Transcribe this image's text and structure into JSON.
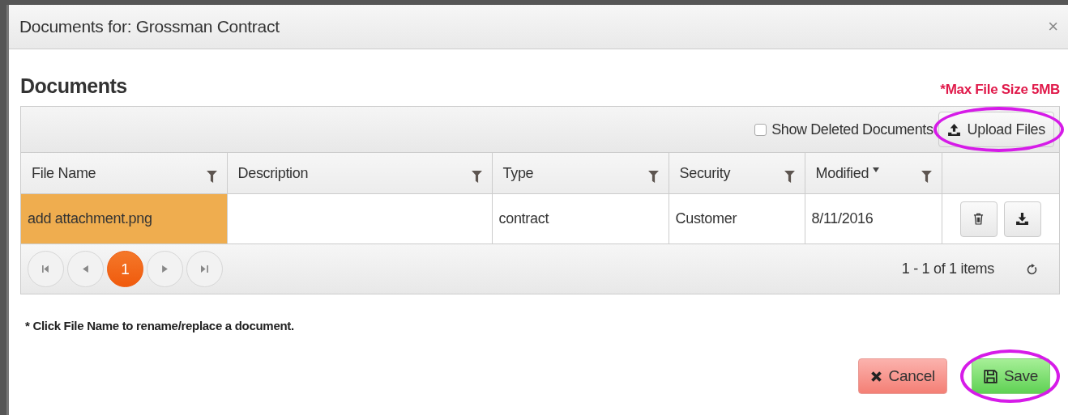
{
  "dialog": {
    "title": "Documents for: Grossman Contract",
    "close": "×"
  },
  "heading": "Documents",
  "max_size_note": "*Max File Size 5MB",
  "toolbar": {
    "show_deleted": {
      "label": "Show Deleted Documents",
      "checked": false
    },
    "upload": {
      "label": "Upload Files",
      "circled": true
    }
  },
  "table": {
    "columns": [
      {
        "label": "File Name",
        "sorted": false
      },
      {
        "label": "Description",
        "sorted": false
      },
      {
        "label": "Type",
        "sorted": false
      },
      {
        "label": "Security",
        "sorted": false
      },
      {
        "label": "Modified",
        "sorted": true
      }
    ],
    "rows": [
      {
        "cells": [
          "add attachment.png",
          "",
          "contract",
          "Customer",
          "8/11/2016"
        ],
        "highlighted": true
      }
    ]
  },
  "pager": {
    "pages": [
      {
        "label": "1",
        "selected": true
      }
    ],
    "summary": "1 - 1 of 1 items"
  },
  "footnote": "* Click File Name to rename/replace a document.",
  "buttons": [
    {
      "kind": "cancel",
      "label": "Cancel",
      "circled": false
    },
    {
      "kind": "save",
      "label": "Save",
      "circled": true
    }
  ]
}
